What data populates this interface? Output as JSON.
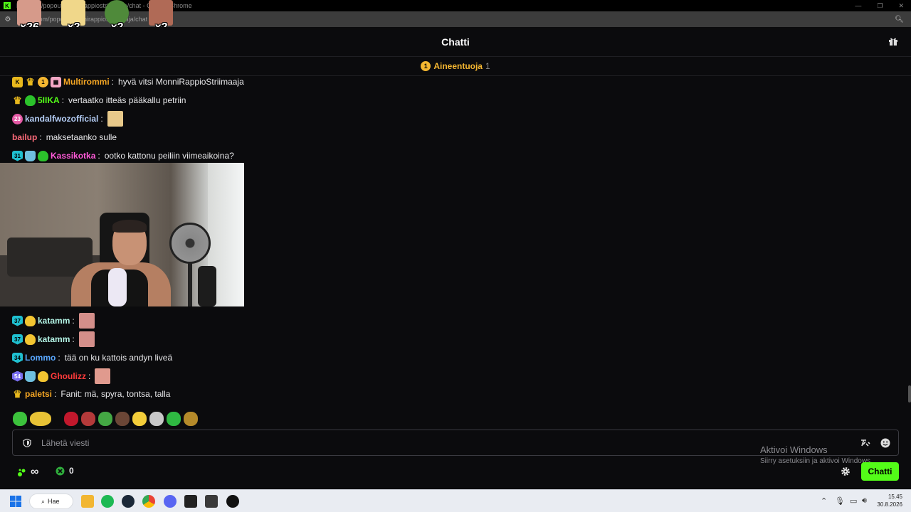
{
  "browser": {
    "title": "kick.com/popout/monnirappiostriimaaja/chat - Google Chrome",
    "url": "kick.com/popout/monnirappiostriimaaja/chat"
  },
  "overlay": {
    "combos": [
      {
        "count": "x26",
        "color": "#d69a8a"
      },
      {
        "count": "x2",
        "color": "#f0d78a"
      },
      {
        "count": "x2",
        "color": "#4f8a3a"
      },
      {
        "count": "x2",
        "color": "#b06a56"
      }
    ]
  },
  "header": {
    "title": "Chatti"
  },
  "pinned": {
    "coin": "1",
    "name": "Aineentuoja",
    "count": "1"
  },
  "messages": [
    {
      "user": "Multirommi",
      "color": "#f5a623",
      "text": "hyvä vitsi MonniRappioStriimaaja"
    },
    {
      "user": "5IIKA",
      "color": "#53fc18",
      "text": "vertaatko itteäs pääkallu petriin"
    },
    {
      "user": "kandalfwozofficial",
      "color": "#b4cdf5",
      "text": ""
    },
    {
      "user": "bailup",
      "color": "#ff6b7a",
      "text": "maksetaanko sulle"
    },
    {
      "user": "Kassikotka",
      "color": "#ff5ad8",
      "text": "ootko kattonu peiliin viimeaikoina?"
    },
    {
      "user": "katamm",
      "color": "#b4f5e6",
      "text": ""
    },
    {
      "user": "katamm",
      "color": "#b4f5e6",
      "text": ""
    },
    {
      "user": "Lommo",
      "color": "#5aa8ff",
      "text": "tää on ku kattois andyn liveä"
    },
    {
      "user": "Ghoulizz",
      "color": "#ff3b3b",
      "text": ""
    },
    {
      "user": "paletsi",
      "color": "#f5a623",
      "text": "Fanit: mä, spyra, tontsa, talla"
    }
  ],
  "badges": {
    "sub31": "31",
    "sub37": "37",
    "sub34": "34",
    "sub54": "54",
    "gift23": "23"
  },
  "input": {
    "placeholder": "Lähetä viesti"
  },
  "watermark": {
    "line1": "Aktivoi Windows",
    "line2": "Siirry asetuksiin ja aktivoi Windows."
  },
  "bottom": {
    "points_value": "∞",
    "kick_points": "0",
    "chat_button": "Chatti"
  },
  "taskbar": {
    "search_label": "Hae",
    "time": "15.45",
    "date": "30.8.2026"
  },
  "colors": {
    "brand": "#53fc18",
    "gold": "#f5b731",
    "background": "#0b0b0d"
  }
}
